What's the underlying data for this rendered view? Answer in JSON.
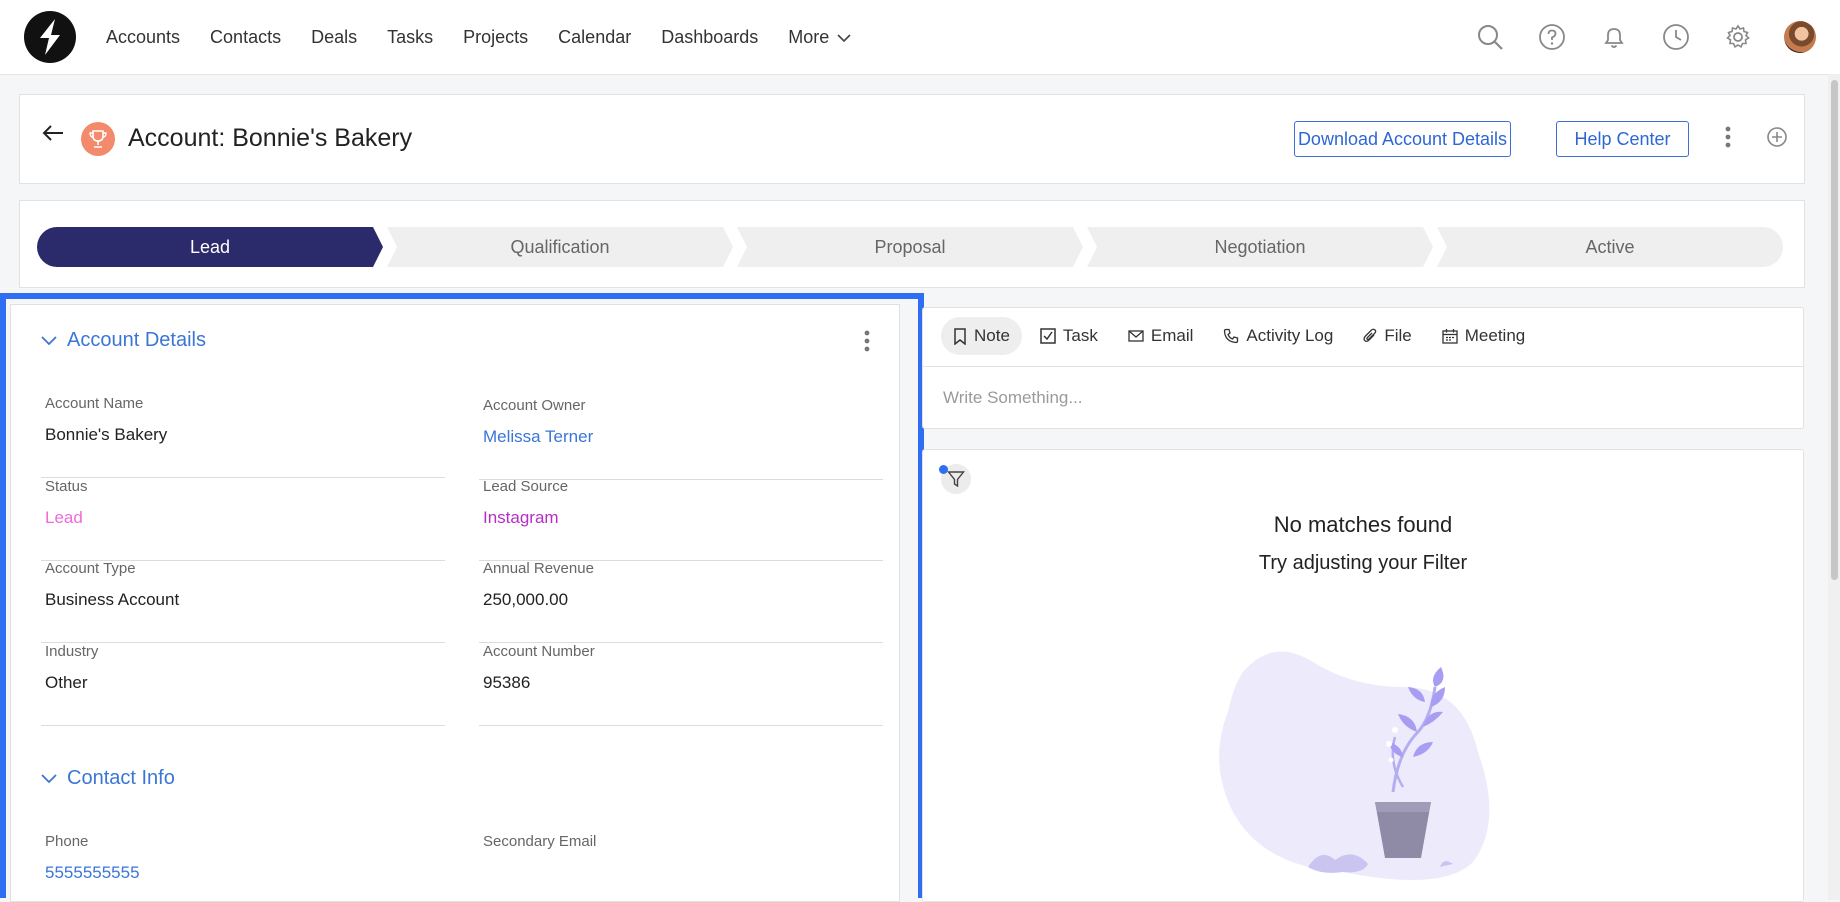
{
  "nav": {
    "items": [
      "Accounts",
      "Contacts",
      "Deals",
      "Tasks",
      "Projects",
      "Calendar",
      "Dashboards"
    ],
    "more_label": "More"
  },
  "header": {
    "title": "Account: Bonnie's Bakery",
    "download_label": "Download Account Details",
    "help_label": "Help Center"
  },
  "pipeline": {
    "stages": [
      "Lead",
      "Qualification",
      "Proposal",
      "Negotiation",
      "Active"
    ],
    "active_stage": "Lead",
    "active_color": "#2b2a6b"
  },
  "account_details": {
    "title": "Account Details",
    "fields": [
      {
        "label": "Account Name",
        "value": "Bonnie's Bakery"
      },
      {
        "label": "Account Owner",
        "value": "Melissa Terner"
      },
      {
        "label": "Status",
        "value": "Lead"
      },
      {
        "label": "Lead Source",
        "value": "Instagram"
      },
      {
        "label": "Account Type",
        "value": "Business Account"
      },
      {
        "label": "Annual Revenue",
        "value": "250,000.00"
      },
      {
        "label": "Industry",
        "value": "Other"
      },
      {
        "label": "Account Number",
        "value": "95386"
      }
    ]
  },
  "contact_info": {
    "title": "Contact Info",
    "fields": [
      {
        "label": "Phone",
        "value": "5555555555"
      },
      {
        "label": "Secondary Email",
        "value": ""
      }
    ]
  },
  "composer": {
    "tabs": [
      "Note",
      "Task",
      "Email",
      "Activity Log",
      "File",
      "Meeting"
    ],
    "active_tab": "Note",
    "placeholder": "Write Something..."
  },
  "feed": {
    "empty_title": "No matches found",
    "empty_subtitle": "Try adjusting your Filter"
  },
  "colors": {
    "accent": "#3b76d6",
    "selection": "#2f6ef3",
    "status_lead": "#ef6bd9",
    "lead_source": "#b52fc6"
  }
}
